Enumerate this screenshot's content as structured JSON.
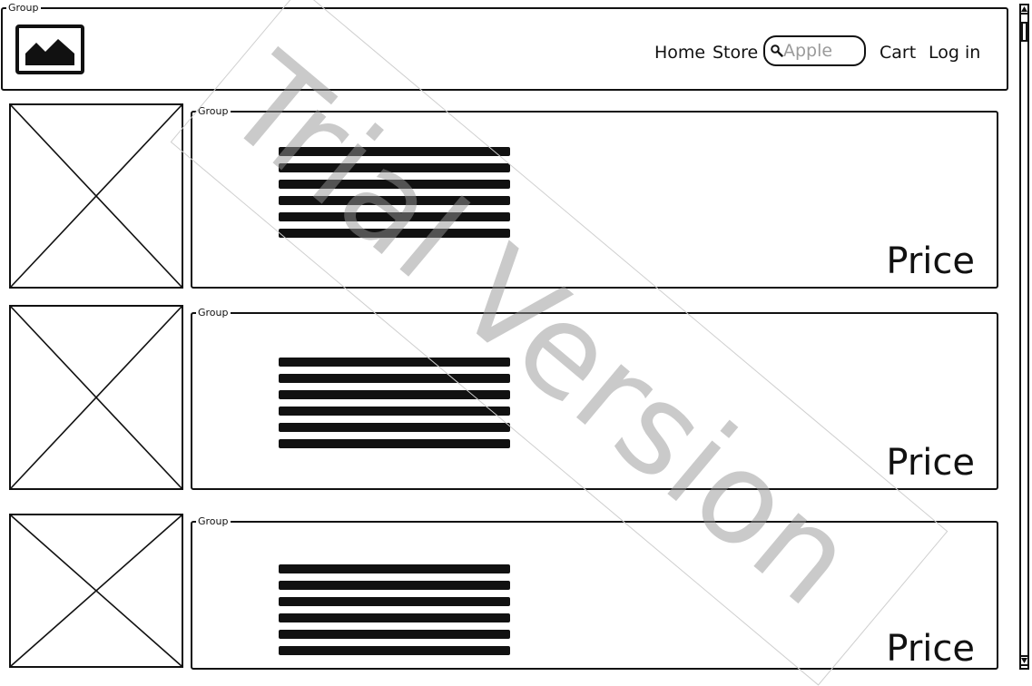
{
  "header": {
    "group_label": "Group",
    "nav": {
      "home": "Home",
      "store": "Store",
      "cart": "Cart",
      "login": "Log in"
    },
    "search": {
      "placeholder": "Apple",
      "icon": "search-icon"
    },
    "logo_icon": "image-icon"
  },
  "products": [
    {
      "group_label": "Group",
      "price_label": "Price",
      "image_icon": "image-placeholder-icon"
    },
    {
      "group_label": "Group",
      "price_label": "Price",
      "image_icon": "image-placeholder-icon"
    },
    {
      "group_label": "Group",
      "price_label": "Price",
      "image_icon": "image-placeholder-icon"
    }
  ],
  "watermark": "Trial Version",
  "colors": {
    "ink": "#111111",
    "watermark": "#969696",
    "placeholder": "#9a9a9a"
  }
}
